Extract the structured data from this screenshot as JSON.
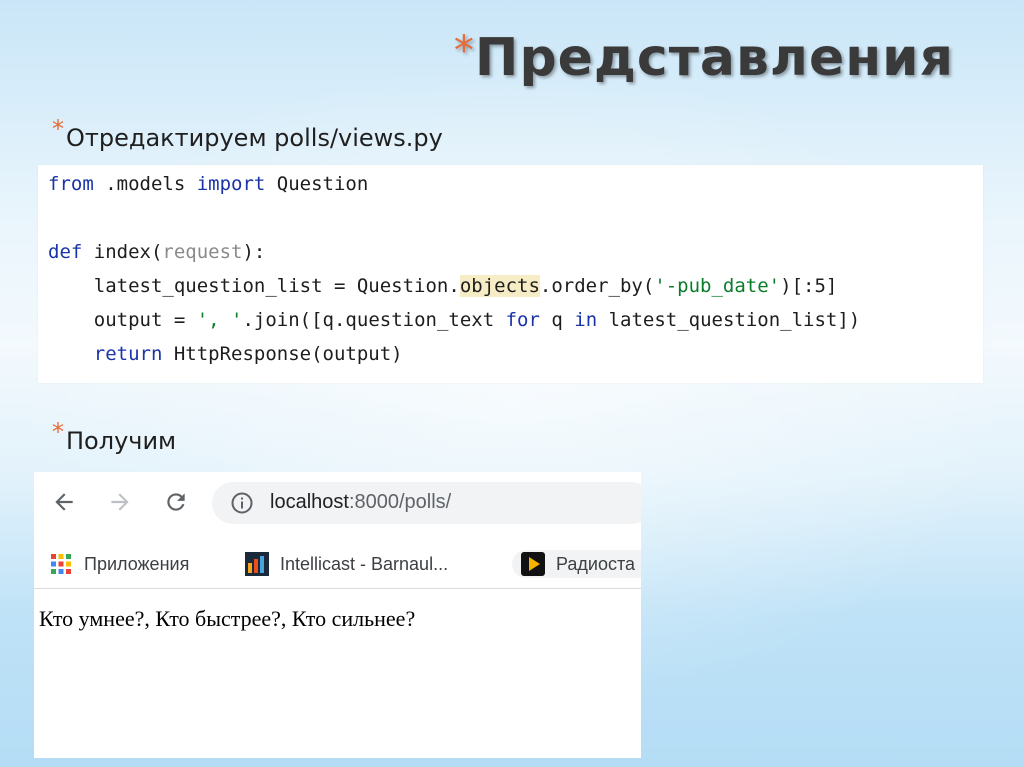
{
  "slide": {
    "title_star": "*",
    "title": "Представления",
    "bullet_star": "*",
    "bullet1": "Отредактируем polls/views.py",
    "bullet2": "Получим"
  },
  "code": {
    "l1": {
      "kw1": "from",
      "t1": " .models ",
      "kw2": "import",
      "t2": " Question"
    },
    "l3": {
      "kw1": "def",
      "t1": " index(",
      "param": "request",
      "t2": "):"
    },
    "l4": {
      "t1": "    latest_question_list = Question.",
      "hl": "objects",
      "t2": ".order_by(",
      "str": "'-pub_date'",
      "t3": ")[:5]"
    },
    "l5": {
      "t1": "    output = ",
      "str": "', '",
      "t2": ".join([q.question_text ",
      "kw1": "for",
      "t3": " q ",
      "kw2": "in",
      "t4": " latest_question_list])"
    },
    "l6": {
      "t1": "    ",
      "kw1": "return",
      "t2": " HttpResponse(output)"
    }
  },
  "browser": {
    "url_host": "localhost",
    "url_path": ":8000/polls/",
    "bookmarks": [
      {
        "label": "Приложения",
        "icon": "apps-grid-icon"
      },
      {
        "label": "Intellicast - Barnaul...",
        "icon": "intellicast-icon"
      },
      {
        "label": "Радиоста",
        "icon": "radio-play-icon"
      }
    ],
    "page_text": "Кто умнее?, Кто быстрее?, Кто сильнее?"
  }
}
